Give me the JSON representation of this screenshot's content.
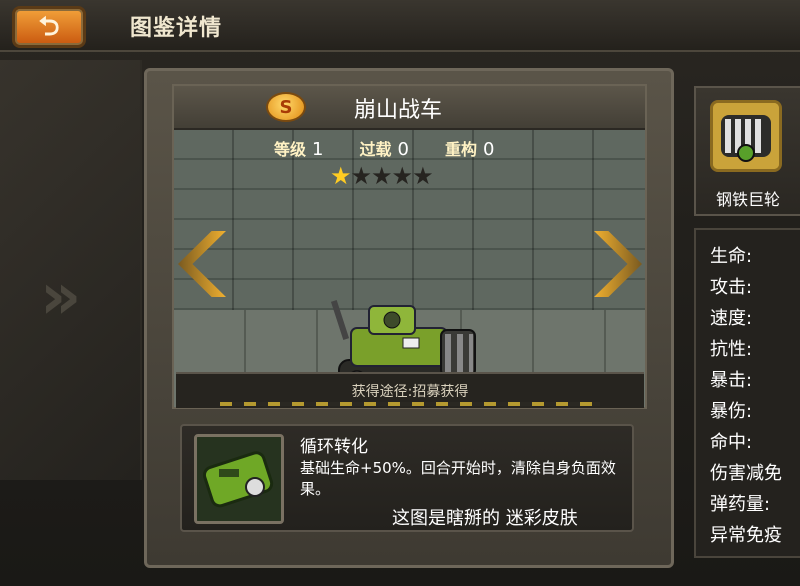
{
  "header": {
    "title": "图鉴详情",
    "back_icon": "return-arrow-icon"
  },
  "card": {
    "name": "崩山战车",
    "rank_badge": "S",
    "level_label": "等级",
    "level_value": "1",
    "overload_label": "过载",
    "overload_value": "0",
    "rebuild_label": "重构",
    "rebuild_value": "0",
    "stars_filled": 1,
    "stars_total": 5,
    "source_text": "获得途径:招募获得"
  },
  "skill": {
    "title": "循环转化",
    "description": "基础生命+50%。回合开始时，清除自身负面效果。"
  },
  "annotation": "这图是瞎掰的    迷彩皮肤",
  "side_item": {
    "label": "钢铁巨轮"
  },
  "attributes": [
    "生命:",
    "攻击:",
    "速度:",
    "抗性:",
    "暴击:",
    "暴伤:",
    "命中:",
    "伤害减免",
    "弹药量:",
    "异常免疫"
  ],
  "colors": {
    "accent": "#f2a13a",
    "star": "#ffcc22",
    "tank_green": "#7aa02a"
  }
}
